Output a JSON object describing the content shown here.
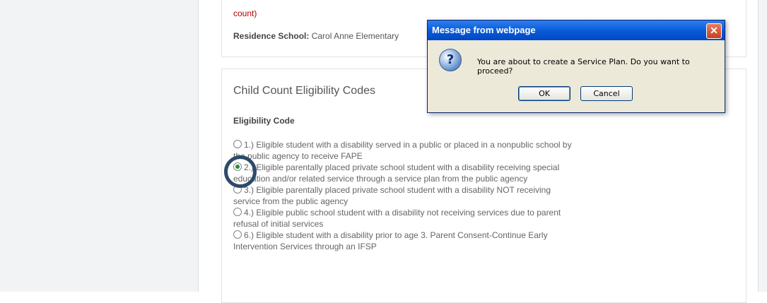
{
  "top_panel": {
    "count_text": "count)",
    "residence_label": "Residence School:",
    "residence_value": "Carol Anne Elementary"
  },
  "eligibility": {
    "section_title": "Child Count Eligibility Codes",
    "field_label": "Eligibility Code",
    "options": [
      {
        "label": "1.) Eligible student with a disability served in a public or placed in a nonpublic school by the public agency to receive FAPE",
        "checked": false
      },
      {
        "label": "2.) Eligible parentally placed private school student with a disability receiving special education and/or related service through a service plan from the public agency",
        "checked": true
      },
      {
        "label": "3.) Eligible parentally placed private school student with a disability NOT receiving service from the public agency",
        "checked": false
      },
      {
        "label": "4.) Eligible public school student with a disability not receiving services due to parent refusal of initial services",
        "checked": false
      },
      {
        "label": "6.) Eligible student with a disability prior to age 3. Parent Consent-Continue Early Intervention Services through an IFSP",
        "checked": false
      }
    ]
  },
  "dialog": {
    "title": "Message from webpage",
    "message": "You are about to create a Service Plan. Do you want to proceed?",
    "ok_label": "OK",
    "cancel_label": "Cancel",
    "close_glyph": "✕",
    "icon_glyph": "?"
  }
}
